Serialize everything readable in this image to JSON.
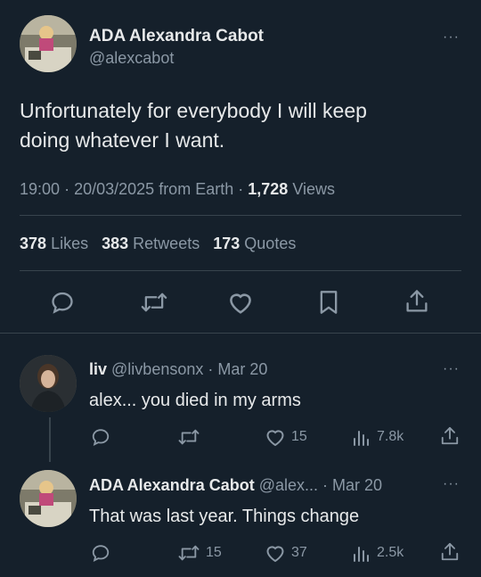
{
  "main_tweet": {
    "display_name": "ADA Alexandra Cabot",
    "handle": "@alexcabot",
    "text_line1": "Unfortunately for everybody I will keep",
    "text_line2": "doing whatever I want.",
    "time": "19:00",
    "date": "20/03/2025",
    "source": "from Earth",
    "views_count": "1,728",
    "views_label": "Views",
    "likes_count": "378",
    "likes_label": "Likes",
    "retweets_count": "383",
    "retweets_label": "Retweets",
    "quotes_count": "173",
    "quotes_label": "Quotes",
    "actions": [
      "reply-icon",
      "retweet-icon",
      "like-icon",
      "bookmark-icon",
      "share-icon"
    ]
  },
  "reply1": {
    "display_name": "liv",
    "handle": "@livbensonx",
    "date": "Mar 20",
    "text": "alex... you died in my arms",
    "likes": "15",
    "views": "7.8k"
  },
  "reply2": {
    "display_name": "ADA Alexandra Cabot",
    "handle": "@alex...",
    "date": "Mar 20",
    "text": "That was last year. Things change",
    "retweets": "15",
    "likes": "37",
    "views": "2.5k"
  },
  "separator": "·",
  "more_glyph": "···",
  "colors": {
    "background": "#15202b",
    "text": "#e7e9ea",
    "muted": "#8b98a5",
    "divider": "#38444d"
  }
}
